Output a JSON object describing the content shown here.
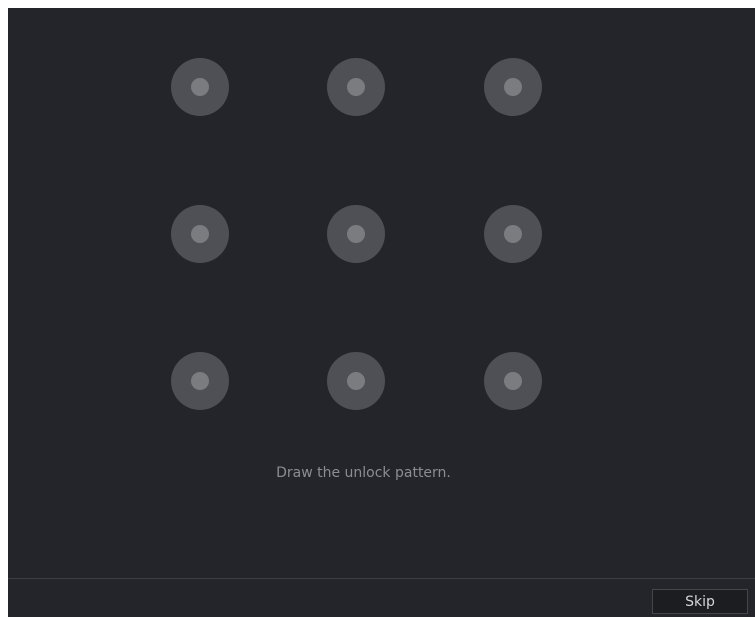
{
  "pattern_lock": {
    "grid": [
      "1",
      "2",
      "3",
      "4",
      "5",
      "6",
      "7",
      "8",
      "9"
    ],
    "hint_text": "Draw the unlock pattern."
  },
  "footer": {
    "skip_label": "Skip"
  },
  "colors": {
    "background": "#23252a",
    "node_outer": "#4e5055",
    "node_inner": "#7a7c80",
    "hint_text": "#8b8d92"
  }
}
